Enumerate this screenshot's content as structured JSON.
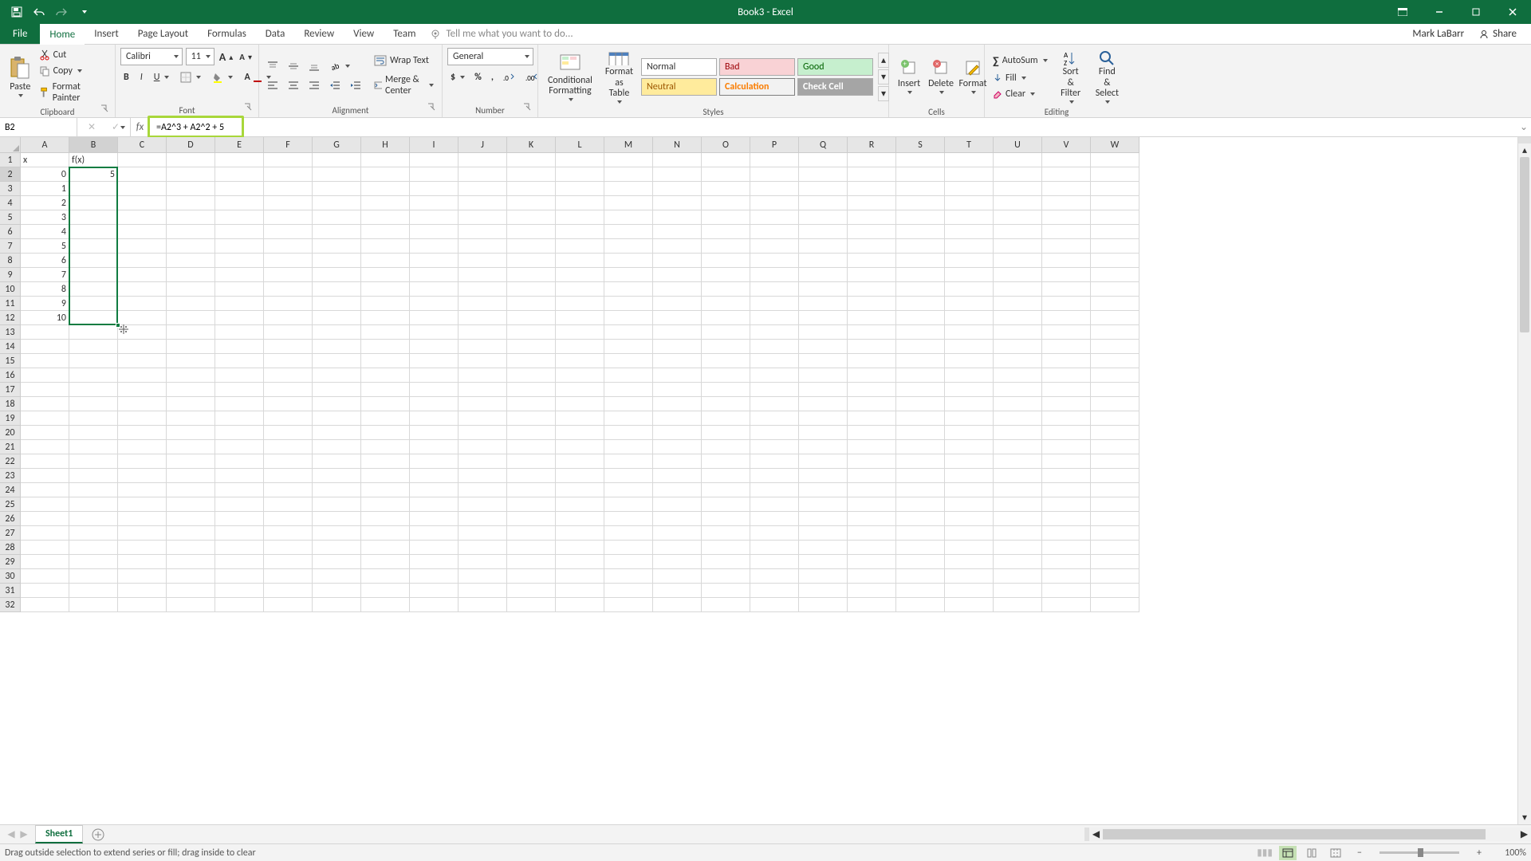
{
  "title": "Book3 - Excel",
  "user": "Mark LaBarr",
  "share": "Share",
  "tabs": [
    "File",
    "Home",
    "Insert",
    "Page Layout",
    "Formulas",
    "Data",
    "Review",
    "View",
    "Team"
  ],
  "active_tab": "Home",
  "tellme": "Tell me what you want to do...",
  "clipboard": {
    "paste": "Paste",
    "cut": "Cut",
    "copy": "Copy",
    "painter": "Format Painter",
    "label": "Clipboard"
  },
  "font": {
    "name": "Calibri",
    "size": "11",
    "label": "Font"
  },
  "alignment": {
    "wrap": "Wrap Text",
    "merge": "Merge & Center",
    "label": "Alignment"
  },
  "number": {
    "format": "General",
    "label": "Number"
  },
  "styles": {
    "cond": "Conditional Formatting",
    "table": "Format as Table",
    "normal": "Normal",
    "bad": "Bad",
    "good": "Good",
    "neutral": "Neutral",
    "calc": "Calculation",
    "check": "Check Cell",
    "label": "Styles"
  },
  "cells": {
    "insert": "Insert",
    "delete": "Delete",
    "format": "Format",
    "label": "Cells"
  },
  "editing": {
    "sum": "AutoSum",
    "fill": "Fill",
    "clear": "Clear",
    "sort": "Sort & Filter",
    "find": "Find & Select",
    "label": "Editing"
  },
  "namebox": "B2",
  "formula": "=A2^3 + A2^2 + 5",
  "columns": [
    "A",
    "B",
    "C",
    "D",
    "E",
    "F",
    "G",
    "H",
    "I",
    "J",
    "K",
    "L",
    "M",
    "N",
    "O",
    "P",
    "Q",
    "R",
    "S",
    "T",
    "U",
    "V",
    "W"
  ],
  "row_count": 32,
  "active_col_idx": 1,
  "active_row": 2,
  "cells_data": {
    "1": {
      "A": "x",
      "B": "f(x)"
    },
    "2": {
      "A": "0",
      "B": "5"
    },
    "3": {
      "A": "1"
    },
    "4": {
      "A": "2"
    },
    "5": {
      "A": "3"
    },
    "6": {
      "A": "4"
    },
    "7": {
      "A": "5"
    },
    "8": {
      "A": "6"
    },
    "9": {
      "A": "7"
    },
    "10": {
      "A": "8"
    },
    "11": {
      "A": "9"
    },
    "12": {
      "A": "10"
    }
  },
  "sel": {
    "col": 1,
    "row_start": 2,
    "row_end": 12
  },
  "sheet": "Sheet1",
  "status": "Drag outside selection to extend series or fill; drag inside to clear",
  "zoom": "100%"
}
